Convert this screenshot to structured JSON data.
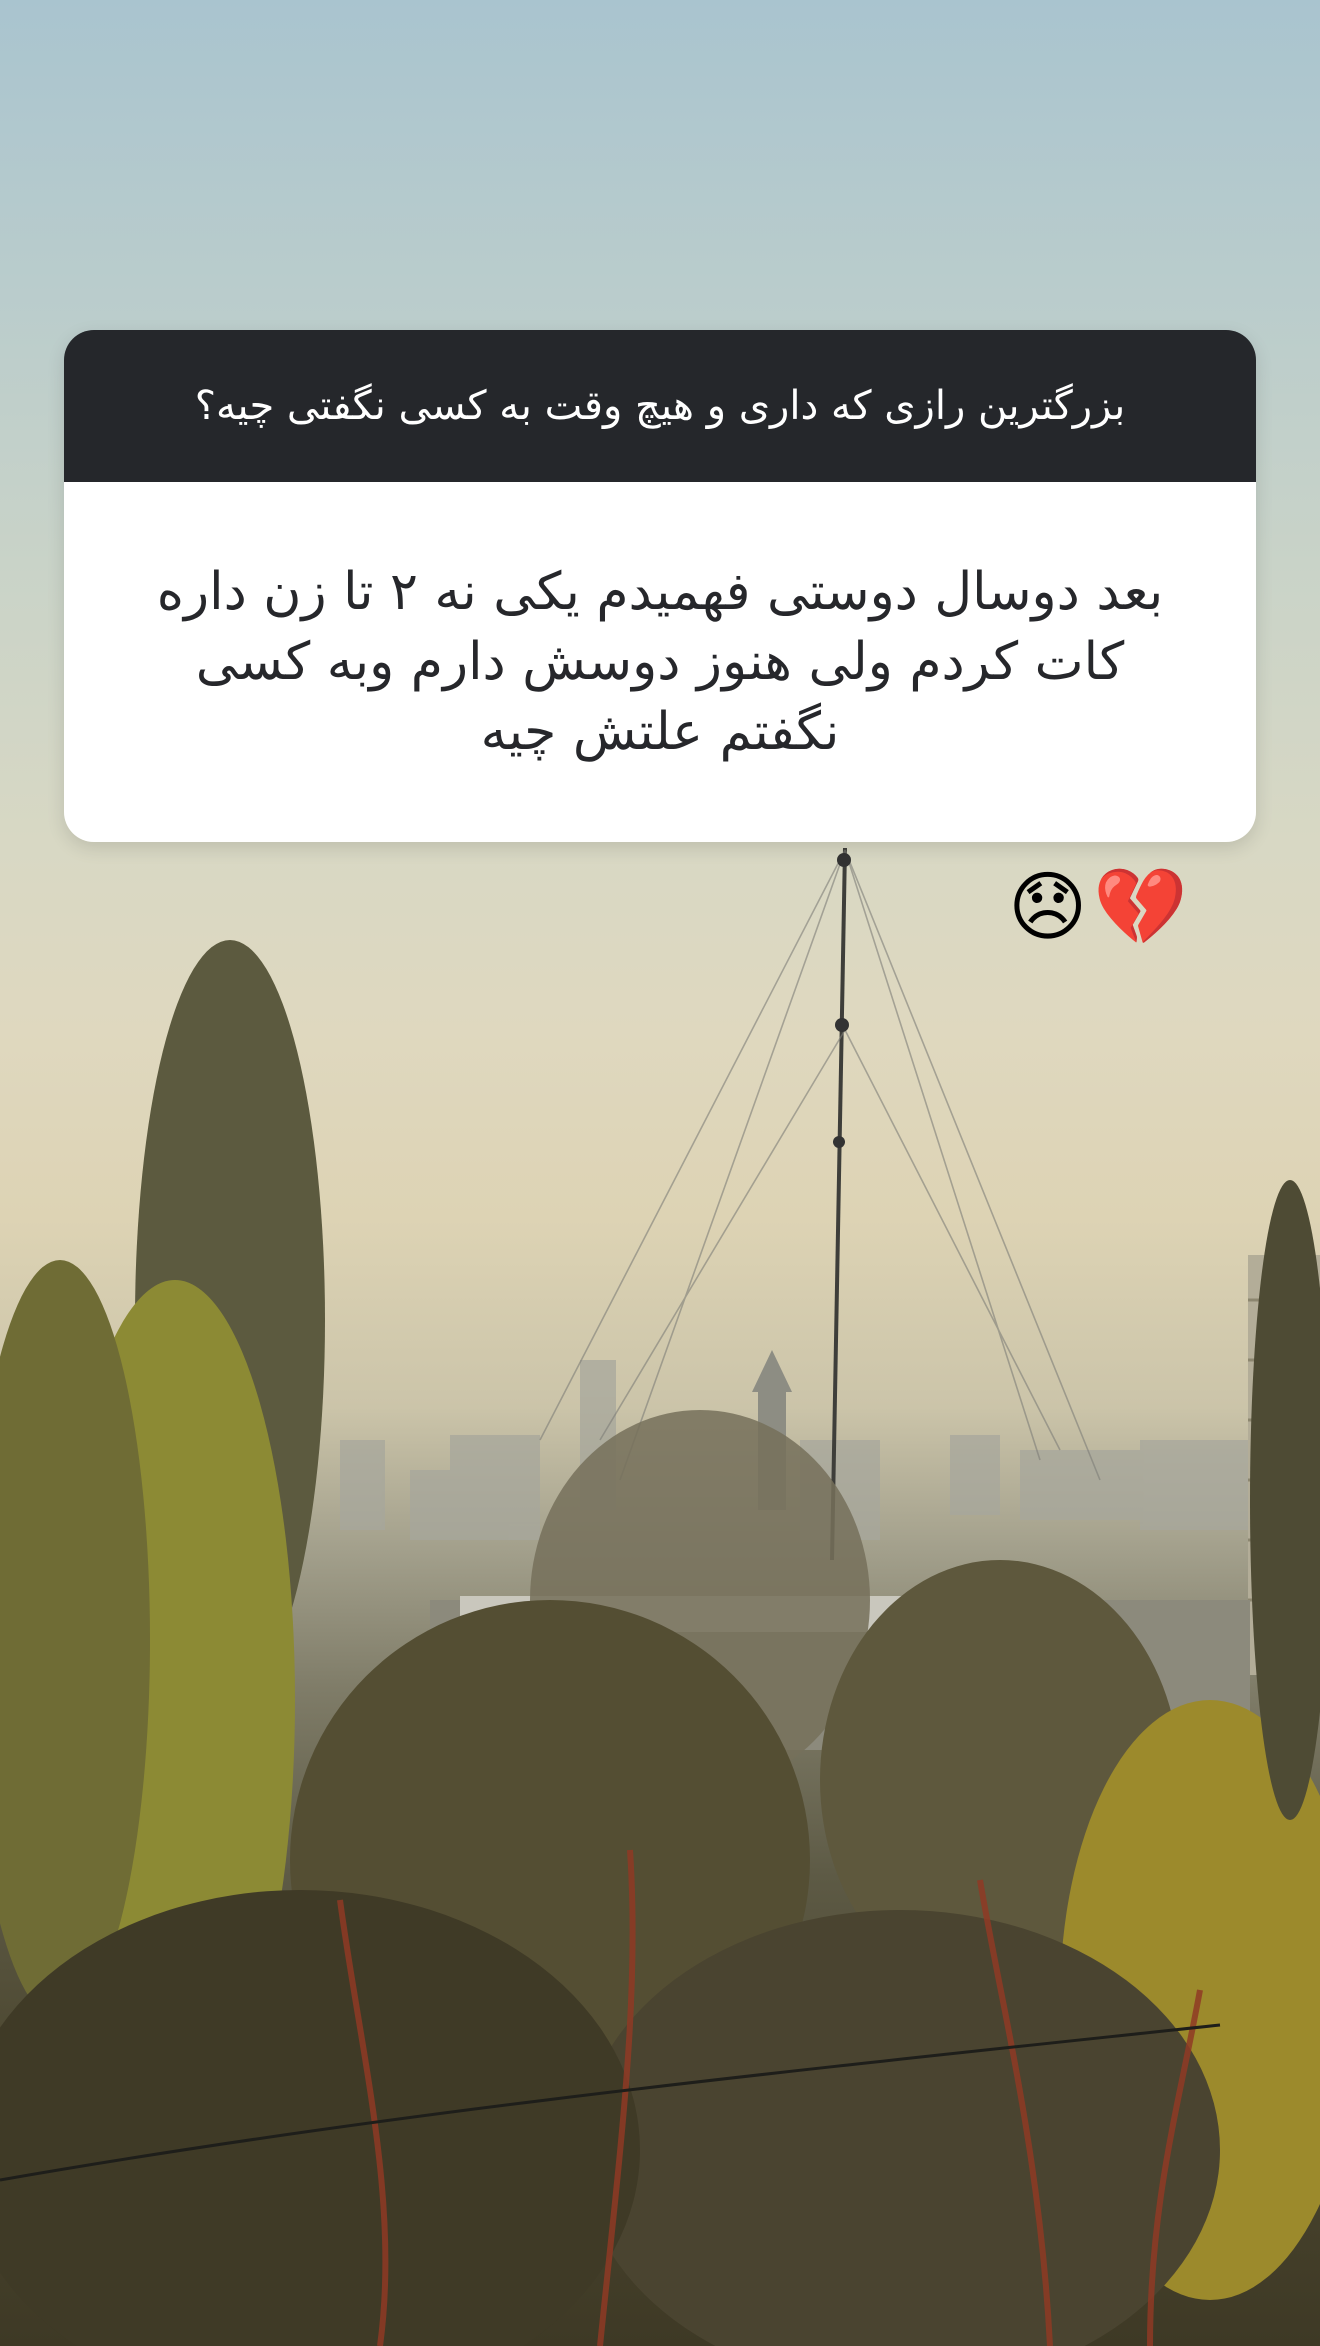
{
  "story": {
    "question_sticker": {
      "question": "بزرگترین رازی که داری و هیچ وقت به کسی نگفتی چیه؟",
      "answer": "بعد دوسال دوستی فهمیدم یکی نه ۲ تا زن داره\nکات کردم ولی هنوز دوسش دارم وبه کسی\nنگفتم علتش چیه"
    },
    "emoji_stickers": [
      {
        "icon": "disappointed-face-icon",
        "glyph": "😞"
      },
      {
        "icon": "broken-heart-icon",
        "glyph": "💔"
      }
    ],
    "background": {
      "sky_top": "#a9c4cf",
      "haze": "#dfd8bf",
      "foliage": "#4c4730"
    }
  }
}
